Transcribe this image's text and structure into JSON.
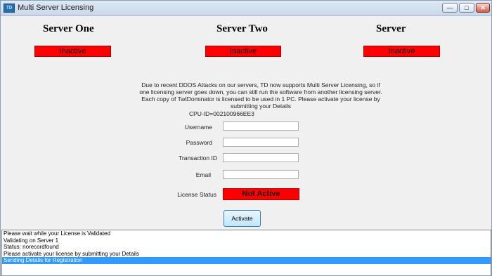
{
  "window": {
    "title": "Multi Server Licensing",
    "icon": "app-icon",
    "buttons": [
      "minimize-icon",
      "restore-icon",
      "close-icon"
    ]
  },
  "servers": [
    {
      "name": "Server One",
      "status": "Inactive"
    },
    {
      "name": "Server Two",
      "status": "Inactive"
    },
    {
      "name": "Server",
      "status": "Inactive"
    }
  ],
  "notice": "Due to recent DDOS Attacks on our servers, TD now supports Multi Server Licensing, so if one licensing server goes down, you can still run the software from another licensing server. Each copy of TwtDominator is licensed to be used in 1 PC. Please activate your license by submitting your Details",
  "cpu_id": "CPU-ID=002100966EE3",
  "form": {
    "username_label": "Username",
    "password_label": "Password",
    "transaction_label": "Transaction ID",
    "email_label": "Email",
    "username_value": "",
    "password_value": "",
    "transaction_value": "",
    "email_value": "",
    "license_status_label": "License Status",
    "license_status_value": "Not Active",
    "activate_label": "Activate"
  },
  "log": [
    "Please wait while your License is Validated",
    "Validating on Server 1",
    "Status: norecordfound",
    "Please activate your license by submitting your Details",
    "Sending Details for Registration"
  ],
  "selected_log_index": 4,
  "colors": {
    "status_red": "#ff0000",
    "selection_blue": "#3399ff",
    "window_bg": "#f0f0f0"
  }
}
